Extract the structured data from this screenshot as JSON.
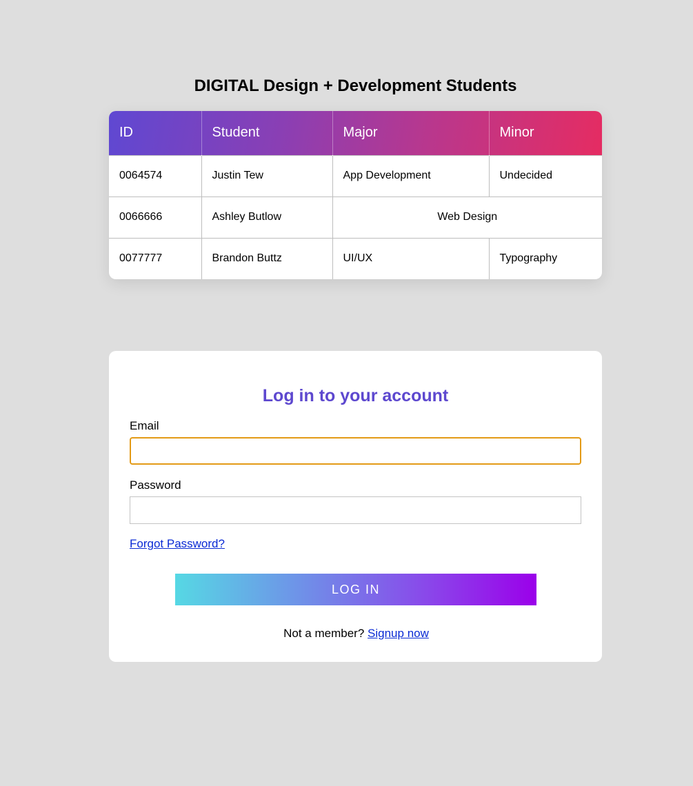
{
  "table": {
    "title": "DIGITAL Design + Development Students",
    "headers": [
      "ID",
      "Student",
      "Major",
      "Minor"
    ],
    "rows": [
      {
        "id": "0064574",
        "student": "Justin Tew",
        "major": "App Development",
        "minor": "Undecided"
      },
      {
        "id": "0066666",
        "student": "Ashley Butlow",
        "major_minor": "Web Design"
      },
      {
        "id": "0077777",
        "student": "Brandon Buttz",
        "major": "UI/UX",
        "minor": "Typography"
      }
    ],
    "header_gradient_colors": [
      "#5f48d2",
      "#8a3fb4",
      "#b9378d",
      "#e52c62"
    ]
  },
  "login": {
    "title": "Log in to your account",
    "email_label": "Email",
    "email_value": "",
    "password_label": "Password",
    "password_value": "",
    "forgot_password": "Forgot Password?",
    "button_label": "LOG IN",
    "signup_prompt": "Not a member?",
    "signup_link": "Signup now",
    "accent_color": "#5d48cf",
    "button_gradient_colors": [
      "#56d8e4",
      "#9b00ea"
    ],
    "focus_color": "#e39a16"
  }
}
